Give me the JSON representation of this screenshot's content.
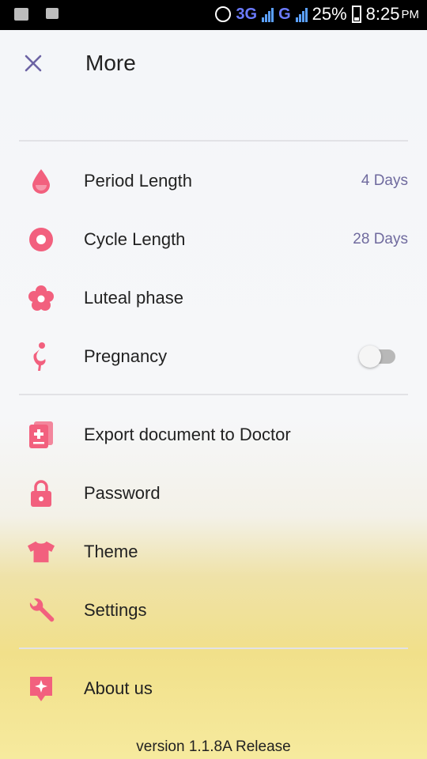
{
  "status_bar": {
    "network_3g": "3G",
    "network_g": "G",
    "battery_percent": "25%",
    "time": "8:25",
    "ampm": "PM"
  },
  "header": {
    "title": "More"
  },
  "menu": {
    "period_length": {
      "label": "Period Length",
      "value": "4 Days"
    },
    "cycle_length": {
      "label": "Cycle Length",
      "value": "28 Days"
    },
    "luteal_phase": {
      "label": "Luteal phase"
    },
    "pregnancy": {
      "label": "Pregnancy",
      "enabled": false
    },
    "export": {
      "label": "Export document to Doctor"
    },
    "password": {
      "label": "Password"
    },
    "theme": {
      "label": "Theme"
    },
    "settings": {
      "label": "Settings"
    },
    "about": {
      "label": "About us"
    }
  },
  "footer": {
    "version": "version 1.1.8A  Release"
  },
  "colors": {
    "accent_pink": "#f2607e",
    "close_purple": "#6c63a4",
    "value_purple": "#6f6a9e"
  }
}
